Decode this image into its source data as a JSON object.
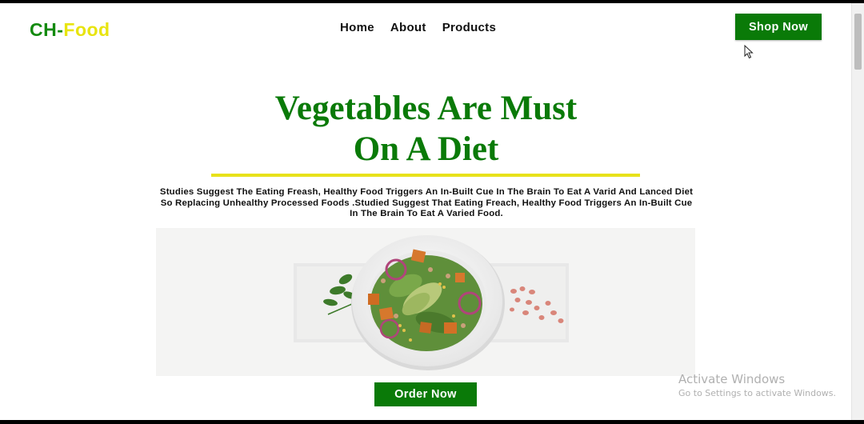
{
  "brand": {
    "part1": "CH-",
    "part2": "Food"
  },
  "nav": {
    "items": [
      "Home",
      "About",
      "Products"
    ]
  },
  "header": {
    "cta_label": "Shop Now"
  },
  "hero": {
    "title_line1": "Vegetables Are Must",
    "title_line2": "On A Diet",
    "description": "Studies Suggest The Eating Freash, Healthy Food Triggers An In-Built Cue In The Brain To Eat A Varid And Lanced Diet So Replacing Unhealthy Processed Foods .Studied Suggest That Eating Freach, Healthy Food Triggers An In-Built Cue In The Brain To Eat A Varied Food.",
    "image_icon": "salad-bowl-icon",
    "order_label": "Order Now"
  },
  "watermark": {
    "title": "Activate Windows",
    "subtitle": "Go to Settings to activate Windows."
  },
  "colors": {
    "brand_green": "#0a7a08",
    "accent_yellow": "#e8e21a",
    "logo_green": "#138a0f"
  }
}
